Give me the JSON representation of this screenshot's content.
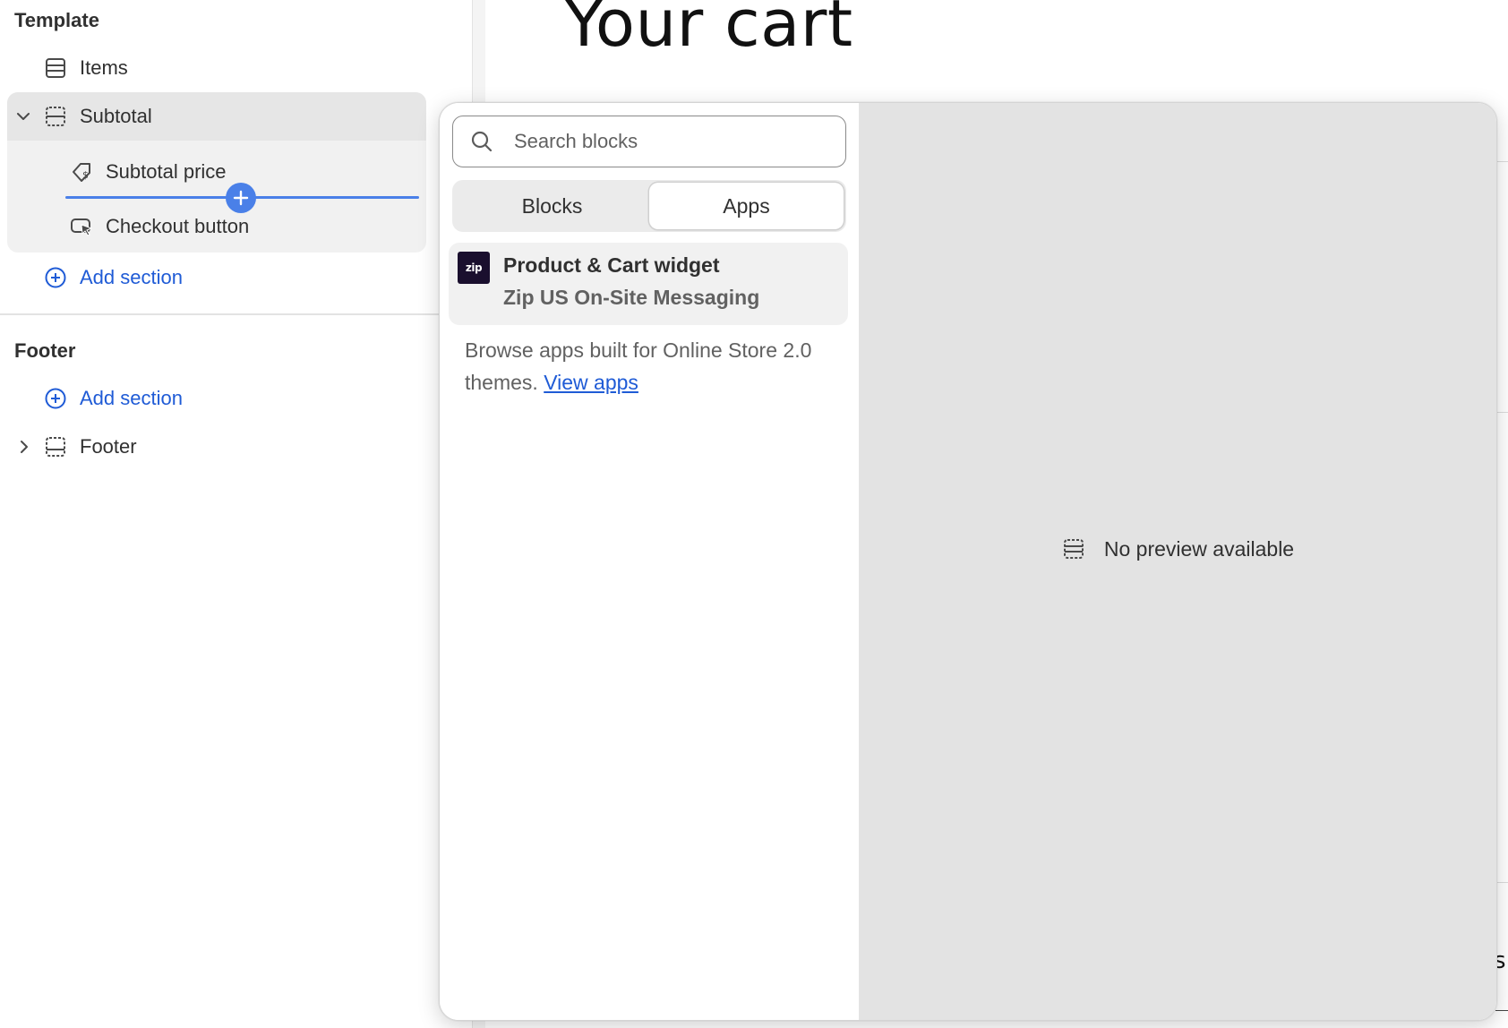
{
  "sidebar": {
    "template_heading": "Template",
    "items_label": "Items",
    "subtotal_label": "Subtotal",
    "subtotal_price_label": "Subtotal price",
    "checkout_button_label": "Checkout button",
    "add_section_label": "Add section",
    "footer_heading": "Footer",
    "footer_add_section_label": "Add section",
    "footer_label": "Footer"
  },
  "preview": {
    "title": "Your cart",
    "edge_letter": "s"
  },
  "popover": {
    "search_placeholder": "Search blocks",
    "tabs": [
      {
        "label": "Blocks",
        "active": false
      },
      {
        "label": "Apps",
        "active": true
      }
    ],
    "app": {
      "logo_text": "zip",
      "title": "Product & Cart widget",
      "subtitle": "Zip US On-Site Messaging"
    },
    "browse_text": "Browse apps built for Online Store 2.0 themes.",
    "view_apps_label": "View apps",
    "no_preview_text": "No preview available"
  },
  "colors": {
    "accent_blue": "#4a80e8",
    "link_blue": "#1f5bd6",
    "panel_gray": "#e3e3e3"
  }
}
